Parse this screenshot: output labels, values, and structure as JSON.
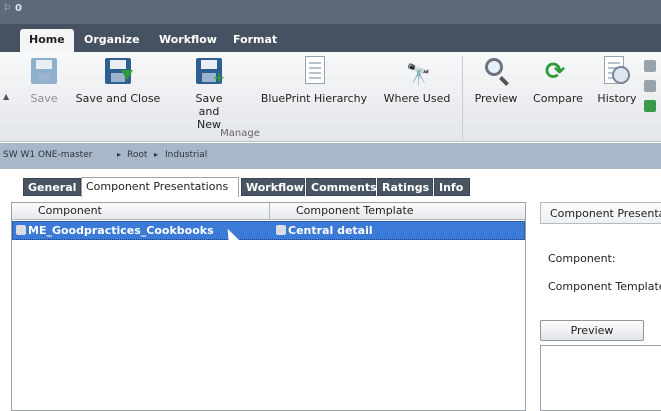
{
  "title": {
    "count": "0"
  },
  "ribbon_tabs": [
    {
      "label": "Home",
      "active": true
    },
    {
      "label": "Organize",
      "active": false
    },
    {
      "label": "Workflow",
      "active": false
    },
    {
      "label": "Format",
      "active": false
    }
  ],
  "ribbon": {
    "buttons": [
      {
        "label": "Save",
        "icon": "save-icon",
        "enabled": false
      },
      {
        "label": "Save and Close",
        "icon": "save-close-icon",
        "enabled": true
      },
      {
        "label": "Save and New",
        "icon": "save-new-icon",
        "enabled": true
      },
      {
        "label": "BluePrint Hierarchy",
        "icon": "blueprint-hierarchy-icon",
        "enabled": true
      },
      {
        "label": "Where Used",
        "icon": "binoculars-icon",
        "enabled": true
      },
      {
        "label": "Preview",
        "icon": "magnifier-icon",
        "enabled": true
      },
      {
        "label": "Compare",
        "icon": "compare-icon",
        "enabled": true
      },
      {
        "label": "History",
        "icon": "history-icon",
        "enabled": true
      }
    ],
    "group_label": "Manage"
  },
  "breadcrumb": [
    "SW W1 ONE-master",
    "Root",
    "Industrial"
  ],
  "page_tabs": [
    {
      "label": "General",
      "active": false
    },
    {
      "label": "Component Presentations",
      "active": true
    },
    {
      "label": "Workflow",
      "active": false
    },
    {
      "label": "Comments",
      "active": false
    },
    {
      "label": "Ratings",
      "active": false
    },
    {
      "label": "Info",
      "active": false
    }
  ],
  "list": {
    "columns": [
      "Component",
      "Component Template"
    ],
    "rows": [
      {
        "component": "ME_Goodpractices_Cookbooks",
        "template": "Central detail",
        "selected": true
      }
    ]
  },
  "details": {
    "tab_label": "Component Presentation",
    "component_label": "Component:",
    "template_label": "Component Template:",
    "preview_button": "Preview"
  },
  "colors": {
    "header_bg": "#465262",
    "breadcrumb_bg": "#a9b8c9",
    "selection": "#3b7ad6"
  }
}
